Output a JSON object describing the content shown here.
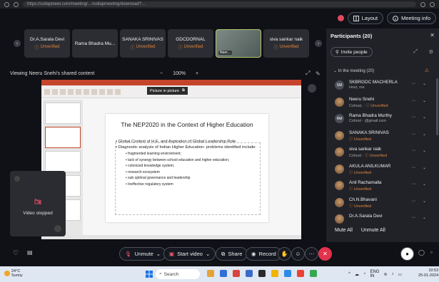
{
  "browser": {
    "url": "https://collapmeet.com/meeting/…/collapmeeting/download?…"
  },
  "header": {
    "layout_label": "Layout",
    "meeting_info_label": "Meeting info"
  },
  "tiles": [
    {
      "name": "Dr.A.Sarala Devi",
      "status": "Unverified"
    },
    {
      "name": "Rama Bhadra Mu...",
      "status": ""
    },
    {
      "name": "SANAKA SRINIVAS",
      "status": "Unverified"
    },
    {
      "name": "GDCDORNAL",
      "status": "Unverified"
    },
    {
      "name": "Neer...",
      "status": "",
      "video": true
    },
    {
      "name": "siva sankar naik",
      "status": "Unverified"
    }
  ],
  "share": {
    "viewing_label": "Viewing Neeru Snehi's shared content",
    "zoom_minus": "−",
    "zoom_value": "100%",
    "zoom_plus": "+",
    "pip_label": "Picture in picture",
    "slide": {
      "title": "The NEP2020 in the Context of Higher Education",
      "bullets": [
        "Global Context of H.E. and Aspiration of Global Leadership Role",
        "Diagnostic analysis of Indian Higher Education- problems identified include:"
      ],
      "sub_bullets": [
        "fragmented learning environment;",
        "lack of synergy between school education and higher education;",
        "colonized knowledge system;",
        "research ecosystem",
        "sub optimal governance and leadership",
        "Ineffective regulatory system"
      ]
    }
  },
  "self_view": {
    "label": "Video stopped"
  },
  "controls": {
    "unmute": "Unmute",
    "start_video": "Start video",
    "share": "Share",
    "record": "Record"
  },
  "panel": {
    "title": "Participants (20)",
    "invite": "Invite people",
    "section": "In the meeting (20)",
    "participants": [
      {
        "initials": "SM",
        "name": "SKBRGDC MACHERLA",
        "sub": "Host, me",
        "unverified": false,
        "photo": false
      },
      {
        "initials": "",
        "name": "Neeru Snehi",
        "sub": "Cohost, ·",
        "unverified": true,
        "photo": true
      },
      {
        "initials": "RM",
        "name": "Rama Bhadra Murthy",
        "sub": "Cohost · @gmail.com",
        "unverified": false,
        "photo": false
      },
      {
        "initials": "",
        "name": "SANAKA SRINIVAS",
        "sub": "",
        "unverified": true,
        "photo": true
      },
      {
        "initials": "",
        "name": "siva sankar naik",
        "sub": "Cohost ·",
        "unverified": true,
        "photo": true
      },
      {
        "initials": "",
        "name": "AKULA ANILKUMAR",
        "sub": "",
        "unverified": true,
        "photo": true
      },
      {
        "initials": "",
        "name": "Anil Rachamalla",
        "sub": "",
        "unverified": true,
        "photo": true
      },
      {
        "initials": "",
        "name": "Ch.N.Bhavani",
        "sub": "",
        "unverified": true,
        "photo": true
      },
      {
        "initials": "",
        "name": "Dr.A.Sarala Devi",
        "sub": "",
        "unverified": false,
        "photo": true
      }
    ],
    "unverified_label": "Unverified",
    "mute_all": "Mute All",
    "unmute_all": "Unmute All"
  },
  "taskbar": {
    "weather_temp": "24°C",
    "weather_desc": "Sunny",
    "search": "Search",
    "lang": "ENG",
    "region": "IN",
    "time": "10:53",
    "date": "25-01-2024"
  },
  "colors": {
    "accent_red": "#e2334d",
    "unverified_orange": "#e0843d",
    "ppt_red": "#c5452c"
  }
}
